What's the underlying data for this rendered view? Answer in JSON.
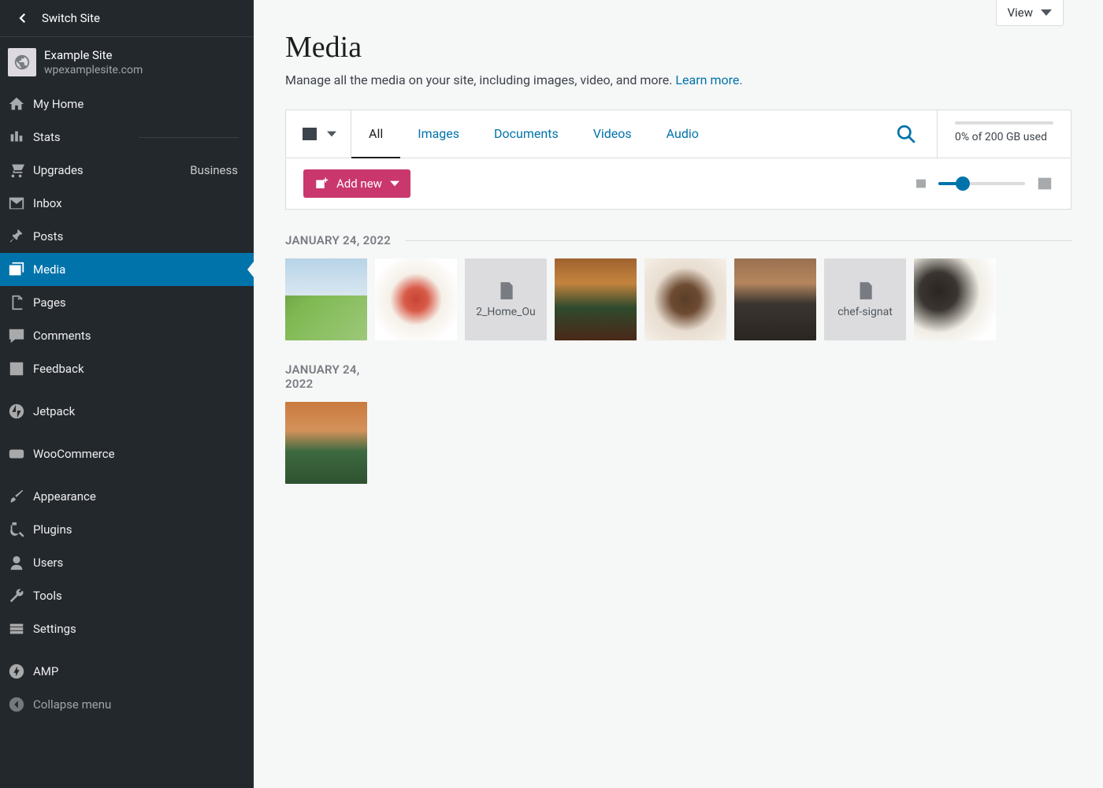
{
  "switchSite": "Switch Site",
  "siteName": "Example Site",
  "siteDomain": "wpexamplesite.com",
  "nav": {
    "myhome": "My Home",
    "stats": "Stats",
    "upgrades": "Upgrades",
    "upgradesBadge": "Business",
    "inbox": "Inbox",
    "posts": "Posts",
    "media": "Media",
    "pages": "Pages",
    "comments": "Comments",
    "feedback": "Feedback",
    "jetpack": "Jetpack",
    "woo": "WooCommerce",
    "appearance": "Appearance",
    "plugins": "Plugins",
    "users": "Users",
    "tools": "Tools",
    "settings": "Settings",
    "amp": "AMP",
    "collapse": "Collapse menu"
  },
  "viewBtn": "View",
  "pageTitle": "Media",
  "pageDesc": "Manage all the media on your site, including images, video, and more. ",
  "learnMore": "Learn more.",
  "tabs": {
    "all": "All",
    "images": "Images",
    "documents": "Documents",
    "videos": "Videos",
    "audio": "Audio"
  },
  "storageText": "0% of 200 GB used",
  "addNew": "Add new",
  "date1": "JANUARY 24, 2022",
  "date2a": "JANUARY 24,",
  "date2b": "2022",
  "docThumb1": "2_Home_Ou",
  "docThumb2": "chef-signat"
}
